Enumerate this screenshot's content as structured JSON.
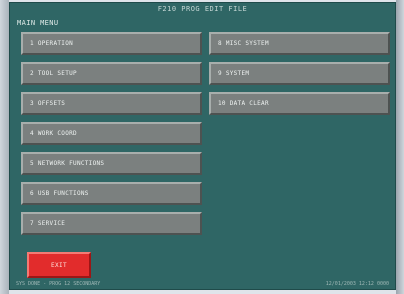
{
  "header": {
    "title": "F210    PROG  EDIT  FILE"
  },
  "section_label": "MAIN MENU",
  "menu_left": [
    {
      "label": "1 OPERATION"
    },
    {
      "label": "2 TOOL SETUP"
    },
    {
      "label": "3 OFFSETS"
    },
    {
      "label": "4 WORK COORD"
    },
    {
      "label": "5 NETWORK FUNCTIONS"
    },
    {
      "label": "6 USB FUNCTIONS"
    },
    {
      "label": "7 SERVICE"
    }
  ],
  "menu_right": [
    {
      "label": "8 MISC SYSTEM"
    },
    {
      "label": "9 SYSTEM"
    },
    {
      "label": "10 DATA CLEAR"
    }
  ],
  "exit_label": "EXIT",
  "status": {
    "left": "SYS DONE   -   PROG 12   SECONDARY",
    "right": "12/01/2003  12:12 0000"
  }
}
